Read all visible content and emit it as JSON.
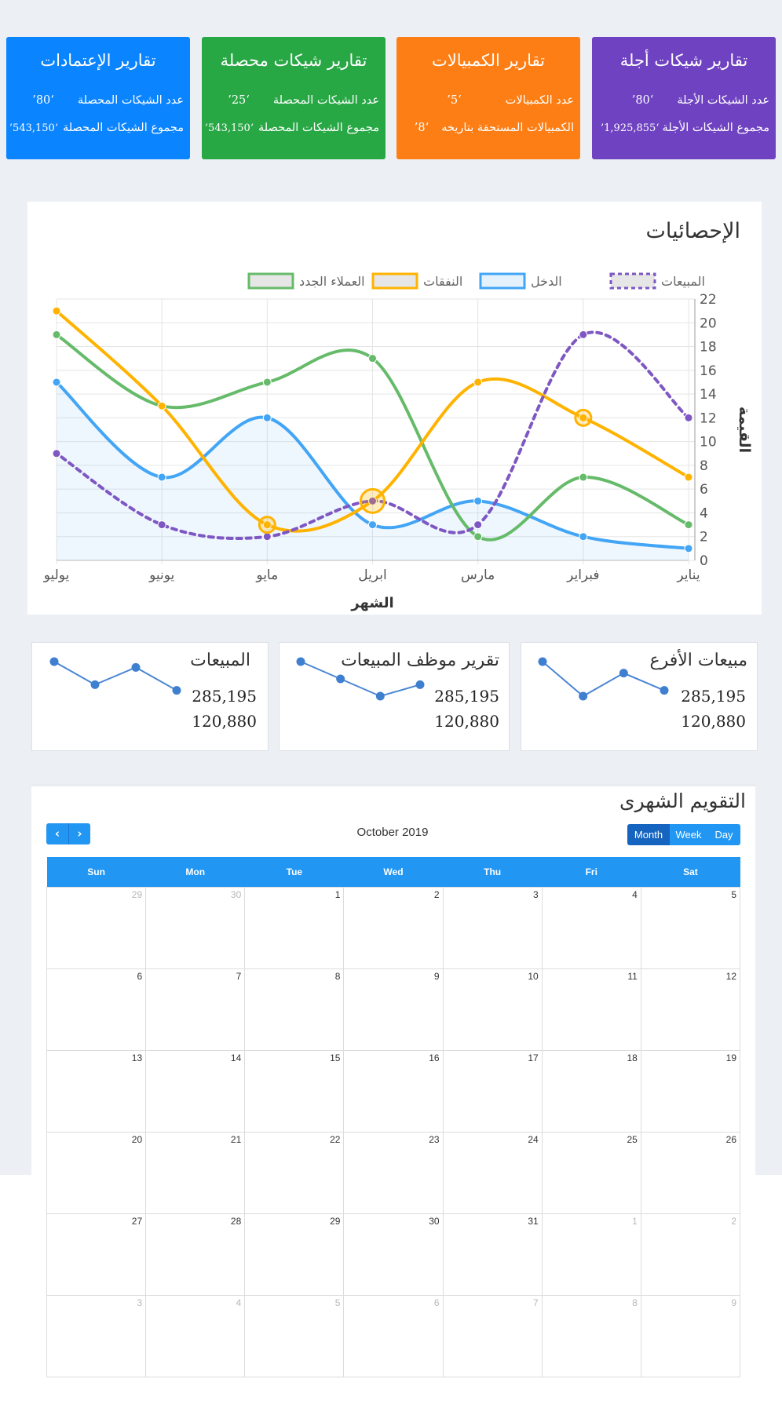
{
  "cards": [
    {
      "title": "تقارير الإعتمادات",
      "row1_label": "عدد الشيكات المحصلة",
      "row1_value": "‘80’",
      "row2_label": "مجموع الشيكات المحصلة",
      "row2_value": "‘543,150’",
      "color": "#0a84ff"
    },
    {
      "title": "تقارير شيكات محصلة",
      "row1_label": "عدد الشيكات المحصلة",
      "row1_value": "‘25’",
      "row2_label": "مجموع الشيكات المحصلة",
      "row2_value": "‘543,150’",
      "color": "#28a745"
    },
    {
      "title": "تقارير الكمبيالات",
      "row1_label": "عدد الكمبيالات",
      "row1_value": "‘5’",
      "row2_label": "الكمبيالات المستحقة بتاريخه",
      "row2_value": "‘8’",
      "color": "#fd7e14"
    },
    {
      "title": "تقارير شيكات أجلة",
      "row1_label": "عدد الشيكات الأجلة",
      "row1_value": "‘80’",
      "row2_label": "مجموع الشيكات الأجلة",
      "row2_value": "‘1,925,855’",
      "color": "#6f42c1"
    }
  ],
  "stats": {
    "title": "الإحصائيات"
  },
  "chart_data": {
    "type": "line",
    "categories": [
      "يناير",
      "فبراير",
      "مارس",
      "ابريل",
      "مايو",
      "يونيو",
      "يوليو"
    ],
    "xlabel": "الشهر",
    "ylabel": "القيمة",
    "ylim": [
      0,
      22
    ],
    "yticks": [
      0,
      2,
      4,
      6,
      8,
      10,
      12,
      14,
      16,
      18,
      20,
      22
    ],
    "grid": true,
    "legend": "top",
    "series": [
      {
        "name": "المبيعات",
        "values": [
          12,
          19,
          3,
          5,
          2,
          3,
          9
        ],
        "color": "#7e57c2",
        "style": "dashed"
      },
      {
        "name": "الدخل",
        "values": [
          1,
          2,
          5,
          3,
          12,
          7,
          15
        ],
        "color": "#42a5f5",
        "style": "filled"
      },
      {
        "name": "النفقات",
        "values": [
          7,
          12,
          15,
          5,
          3,
          13,
          21
        ],
        "color": "#ffb300",
        "style": "solid"
      },
      {
        "name": "العملاء الجدد",
        "values": [
          3,
          7,
          2,
          17,
          15,
          13,
          19
        ],
        "color": "#66bb6a",
        "style": "solid"
      }
    ]
  },
  "mini_cards": [
    {
      "title": "المبيعات",
      "value1": "285,195",
      "value2": "120,880",
      "spark": [
        7,
        3,
        6,
        2
      ]
    },
    {
      "title": "تقرير موظف المبيعات",
      "value1": "285,195",
      "value2": "120,880",
      "spark": [
        7,
        4,
        1,
        3
      ]
    },
    {
      "title": "مبيعات الأفرع",
      "value1": "285,195",
      "value2": "120,880",
      "spark": [
        7,
        1,
        5,
        2
      ]
    }
  ],
  "calendar": {
    "title": "التقويم الشهرى",
    "month_label": "October 2019",
    "prev_icon": "‹",
    "next_icon": "›",
    "views": [
      "Month",
      "Week",
      "Day"
    ],
    "active_view": "Month",
    "weekdays": [
      "Sun",
      "Mon",
      "Tue",
      "Wed",
      "Thu",
      "Fri",
      "Sat"
    ],
    "weeks": [
      [
        "29",
        "30",
        "1",
        "2",
        "3",
        "4",
        "5"
      ],
      [
        "6",
        "7",
        "8",
        "9",
        "10",
        "11",
        "12"
      ],
      [
        "13",
        "14",
        "15",
        "16",
        "17",
        "18",
        "19"
      ],
      [
        "20",
        "21",
        "22",
        "23",
        "24",
        "25",
        "26"
      ],
      [
        "27",
        "28",
        "29",
        "30",
        "31",
        "1",
        "2"
      ],
      [
        "3",
        "4",
        "5",
        "6",
        "7",
        "8",
        "9"
      ]
    ],
    "other_month": [
      [
        true,
        true,
        false,
        false,
        false,
        false,
        false
      ],
      [
        false,
        false,
        false,
        false,
        false,
        false,
        false
      ],
      [
        false,
        false,
        false,
        false,
        false,
        false,
        false
      ],
      [
        false,
        false,
        false,
        false,
        false,
        false,
        false
      ],
      [
        false,
        false,
        false,
        false,
        false,
        true,
        true
      ],
      [
        true,
        true,
        true,
        true,
        true,
        true,
        true
      ]
    ]
  }
}
